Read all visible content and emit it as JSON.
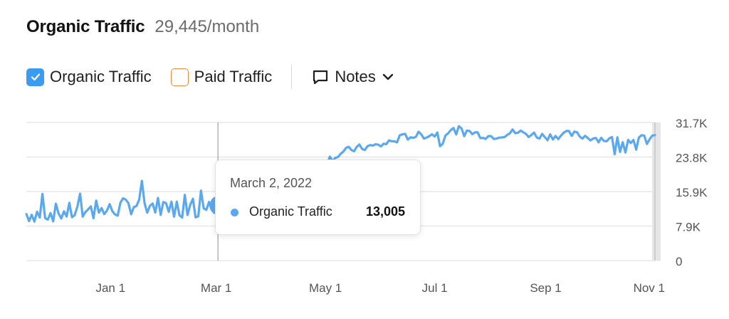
{
  "header": {
    "title": "Organic Traffic",
    "metric": "29,445/month"
  },
  "legend": {
    "organic_label": "Organic Traffic",
    "organic_checked": true,
    "paid_label": "Paid Traffic",
    "paid_checked": false,
    "notes_label": "Notes"
  },
  "colors": {
    "organic": "#5aa8ee",
    "paid": "#ee8a3c",
    "checkbox": "#3b9bf0"
  },
  "icons": {
    "checkbox": "checkmark-icon",
    "notes": "speech-bubble-icon",
    "dropdown": "chevron-down-icon"
  },
  "tooltip": {
    "date": "March 2, 2022",
    "series": "Organic Traffic",
    "value": "13,005"
  },
  "chart_data": {
    "type": "line",
    "title": "",
    "xlabel": "",
    "ylabel": "",
    "x_ticks": [
      "Jan 1",
      "Mar 1",
      "May 1",
      "Jul 1",
      "Sep 1",
      "Nov 1"
    ],
    "y_ticks": [
      "31.7K",
      "23.8K",
      "15.9K",
      "7.9K",
      "0"
    ],
    "ylim": [
      0,
      31700
    ],
    "grid": true,
    "legend_position": "top-left",
    "highlight": {
      "date": "2022-03-02",
      "value": 13005
    },
    "series": [
      {
        "name": "Organic Traffic",
        "dates": [
          "2021-11-01",
          "2022-01-01",
          "2022-01-15",
          "2022-02-01",
          "2022-02-15",
          "2022-03-02",
          "2022-03-15",
          "2022-04-01",
          "2022-04-15",
          "2022-05-01",
          "2022-05-15",
          "2022-06-01",
          "2022-06-15",
          "2022-07-01",
          "2022-07-15",
          "2022-08-01",
          "2022-08-15",
          "2022-09-01",
          "2022-09-15",
          "2022-10-01",
          "2022-10-15",
          "2022-11-01"
        ],
        "values": [
          10500,
          11500,
          13000,
          12500,
          11500,
          13005,
          16500,
          18000,
          20500,
          23000,
          25500,
          26500,
          28500,
          29000,
          30000,
          28500,
          29500,
          28500,
          29000,
          28000,
          27500,
          28300
        ]
      },
      {
        "name": "Paid Traffic",
        "visible": false,
        "values": []
      }
    ]
  }
}
